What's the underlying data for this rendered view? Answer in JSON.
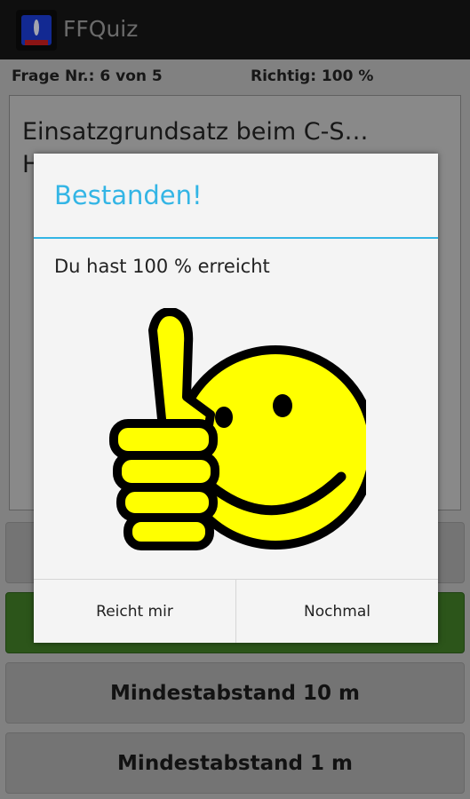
{
  "app": {
    "title": "FFQuiz",
    "icon": "app-icon"
  },
  "status": {
    "question_counter": "Frage Nr.: 6 von 5",
    "score": "Richtig: 100 %"
  },
  "question": {
    "text": "Einsatzgrundsatz beim C-S… H…"
  },
  "answers": [
    {
      "label": ""
    },
    {
      "label": ""
    },
    {
      "label": "Mindestabstand 10 m"
    },
    {
      "label": "Mindestabstand 1 m"
    }
  ],
  "dialog": {
    "title": "Bestanden!",
    "message": "Du hast 100 % erreicht",
    "image": "thumbs-up-smiley-icon",
    "buttons": {
      "negative": "Reicht mir",
      "positive": "Nochmal"
    }
  },
  "colors": {
    "accent": "#33b5e5",
    "correct_answer": "#3f7a26",
    "smiley_yellow": "#ffff00"
  }
}
